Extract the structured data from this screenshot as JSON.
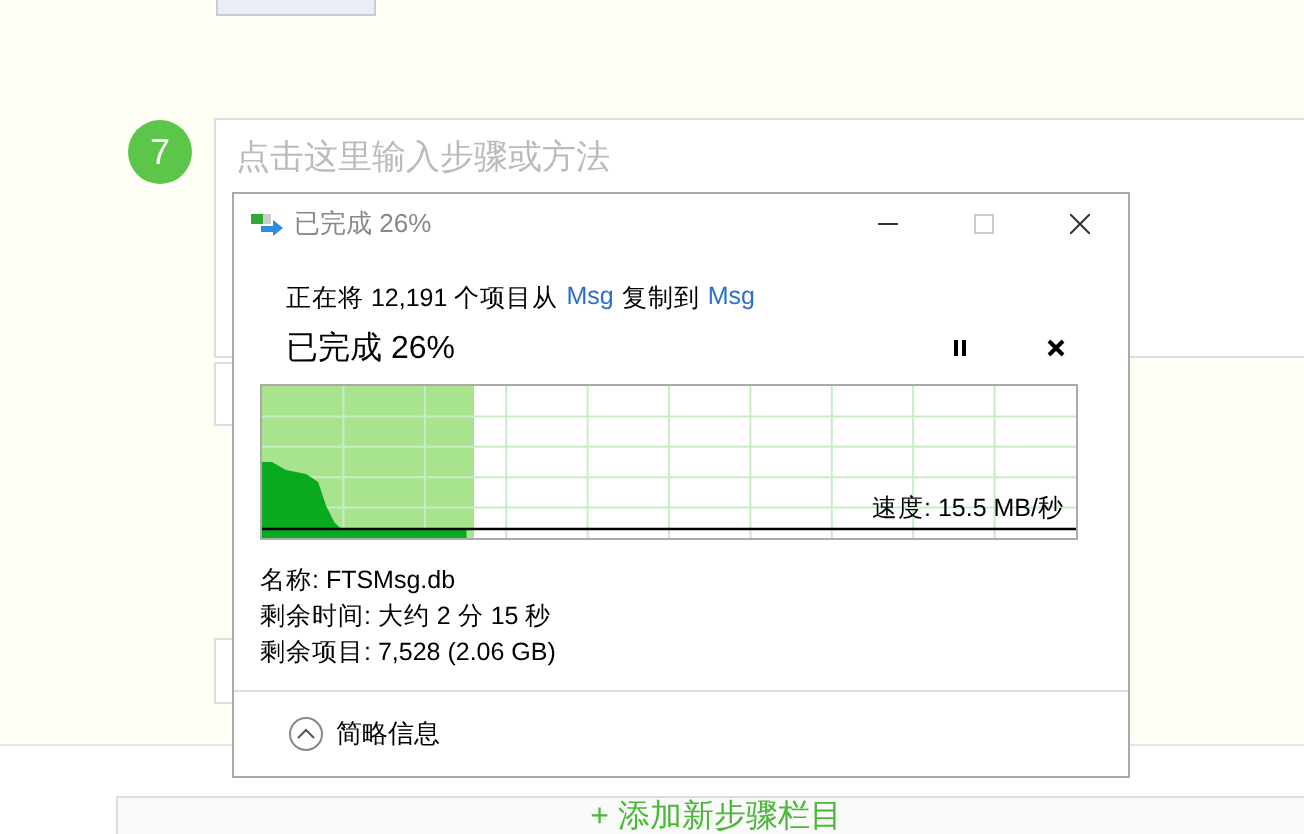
{
  "page": {
    "step": {
      "number": "7",
      "placeholder": "点击这里输入步骤或方法"
    },
    "add_step_button": "+ 添加新步骤栏目"
  },
  "dialog": {
    "title": "已完成 26%",
    "summary": [
      {
        "kind": "text",
        "text": "正在将 12,191 个项目从"
      },
      {
        "kind": "link",
        "text": "Msg"
      },
      {
        "kind": "text",
        "text": "复制到"
      },
      {
        "kind": "link",
        "text": "Msg"
      }
    ],
    "heading": "已完成 26%",
    "progress": {
      "level": 0.26,
      "speed": "速度: 15.5 MB/秒"
    },
    "details": [
      "名称: FTSMsg.db",
      "剩余时间: 大约 2 分 15 秒",
      "剩余项目: 7,528 (2.06 GB)"
    ],
    "collapse_label": "简略信息"
  }
}
